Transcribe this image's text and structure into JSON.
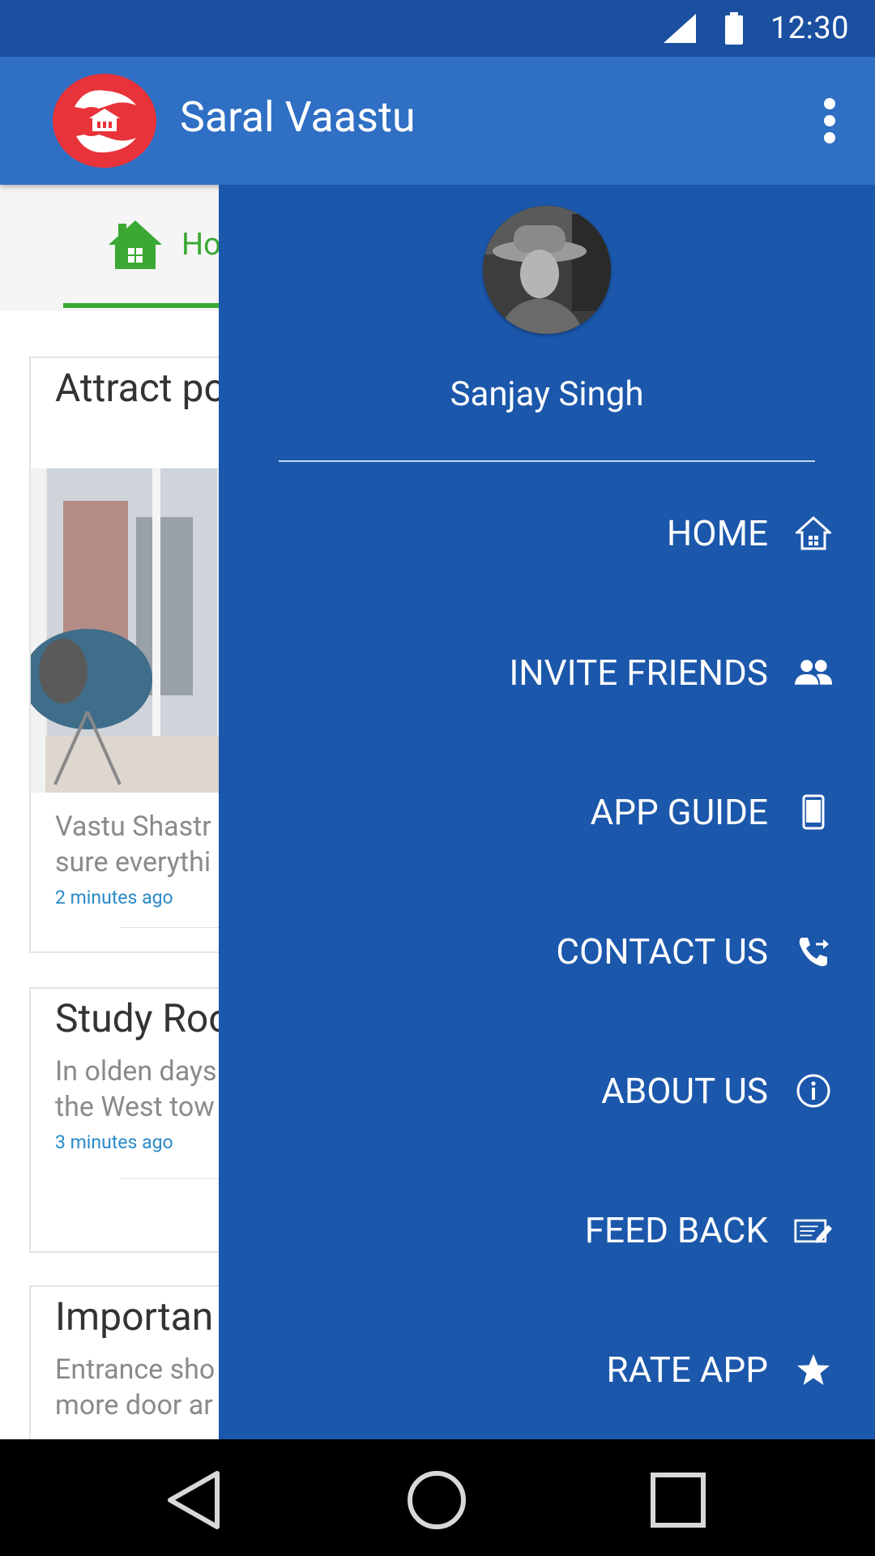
{
  "status_bar": {
    "time": "12:30",
    "icons": [
      "cell-signal-icon",
      "battery-icon"
    ]
  },
  "app_bar": {
    "title": "Saral Vaastu",
    "logo": "saral-vaastu-logo",
    "menu_icon": "more-vert-icon"
  },
  "tabs": [
    {
      "label": "Ho",
      "icon": "home-icon",
      "selected": true
    }
  ],
  "cards": [
    {
      "title": "Attract po",
      "desc_line1": "Vastu Shastr",
      "desc_line2": "sure everythi",
      "time": "2 minutes ago"
    },
    {
      "title": "Study Roo",
      "desc_line1": "In olden days",
      "desc_line2": "the West tow",
      "time": "3 minutes ago"
    },
    {
      "title": "Importan",
      "desc_line1": "Entrance sho",
      "desc_line2": "more door ar"
    }
  ],
  "drawer": {
    "user_name": "Sanjay Singh",
    "items": [
      {
        "label": "HOME",
        "icon": "home-icon"
      },
      {
        "label": "INVITE FRIENDS",
        "icon": "people-icon"
      },
      {
        "label": "APP GUIDE",
        "icon": "phone-icon"
      },
      {
        "label": "CONTACT US",
        "icon": "call-forward-icon"
      },
      {
        "label": "ABOUT US",
        "icon": "info-icon"
      },
      {
        "label": "FEED BACK",
        "icon": "feedback-icon"
      },
      {
        "label": "RATE APP",
        "icon": "star-icon"
      }
    ]
  },
  "colors": {
    "status_bar": "#1b4fa0",
    "app_bar": "#2f6fc4",
    "drawer": "#1b57ab",
    "accent_green": "#3aa832",
    "time_blue": "#2a89c8"
  },
  "nav_bar": {
    "buttons": [
      "back-icon",
      "home-circle-icon",
      "recents-icon"
    ]
  }
}
